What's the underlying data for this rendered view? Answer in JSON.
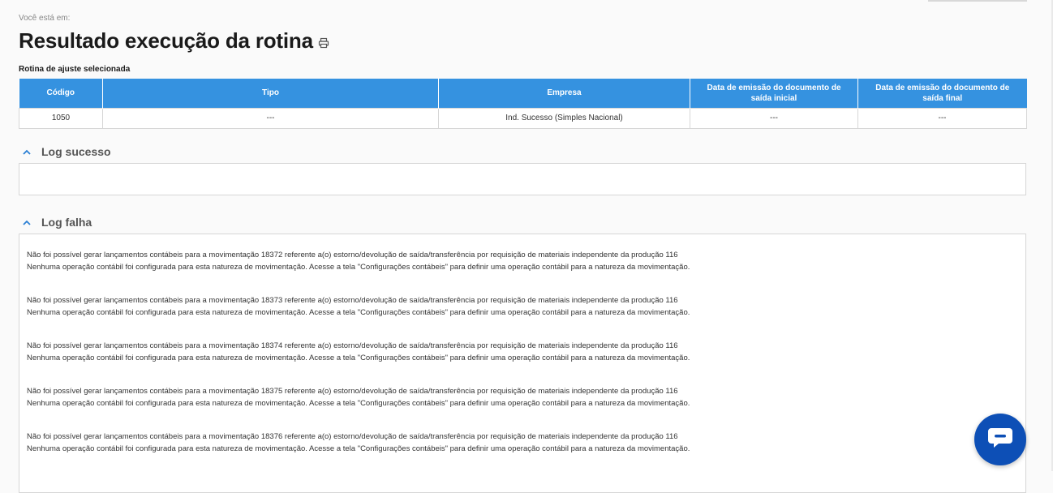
{
  "breadcrumb": "Você está em:",
  "page_title": "Resultado execução da rotina",
  "section_label": "Rotina de ajuste selecionada",
  "table": {
    "headers": [
      "Código",
      "Tipo",
      "Empresa",
      "Data de emissão do documento de saída inicial",
      "Data de emissão do documento de saída final"
    ],
    "row": [
      "1050",
      "---",
      "Ind. Sucesso (Simples Nacional)",
      "---",
      "---"
    ]
  },
  "log_sucesso": {
    "title": "Log sucesso"
  },
  "log_falha": {
    "title": "Log falha",
    "entries": [
      {
        "line1": "Não foi possível gerar lançamentos contábeis para a movimentação 18372 referente a(o) estorno/devolução de saída/transferência por requisição de materiais independente da produção 116",
        "line2": "Nenhuma operação contábil foi configurada para esta natureza de movimentação. Acesse a tela \"Configurações contábeis\" para definir uma operação contábil para a natureza da movimentação."
      },
      {
        "line1": "Não foi possível gerar lançamentos contábeis para a movimentação 18373 referente a(o) estorno/devolução de saída/transferência por requisição de materiais independente da produção 116",
        "line2": "Nenhuma operação contábil foi configurada para esta natureza de movimentação. Acesse a tela \"Configurações contábeis\" para definir uma operação contábil para a natureza da movimentação."
      },
      {
        "line1": "Não foi possível gerar lançamentos contábeis para a movimentação 18374 referente a(o) estorno/devolução de saída/transferência por requisição de materiais independente da produção 116",
        "line2": "Nenhuma operação contábil foi configurada para esta natureza de movimentação. Acesse a tela \"Configurações contábeis\" para definir uma operação contábil para a natureza da movimentação."
      },
      {
        "line1": "Não foi possível gerar lançamentos contábeis para a movimentação 18375 referente a(o) estorno/devolução de saída/transferência por requisição de materiais independente da produção 116",
        "line2": "Nenhuma operação contábil foi configurada para esta natureza de movimentação. Acesse a tela \"Configurações contábeis\" para definir uma operação contábil para a natureza da movimentação."
      },
      {
        "line1": "Não foi possível gerar lançamentos contábeis para a movimentação 18376 referente a(o) estorno/devolução de saída/transferência por requisição de materiais independente da produção 116",
        "line2": "Nenhuma operação contábil foi configurada para esta natureza de movimentação. Acesse a tela \"Configurações contábeis\" para definir uma operação contábil para a natureza da movimentação."
      }
    ]
  },
  "icons": {
    "print": "printer-icon",
    "collapse": "chevron-up-icon",
    "chat": "chat-bubble-icon"
  },
  "colors": {
    "table_header": "#3592e0",
    "chevron": "#2a7fd4",
    "chat_button": "#0d4fb6"
  }
}
